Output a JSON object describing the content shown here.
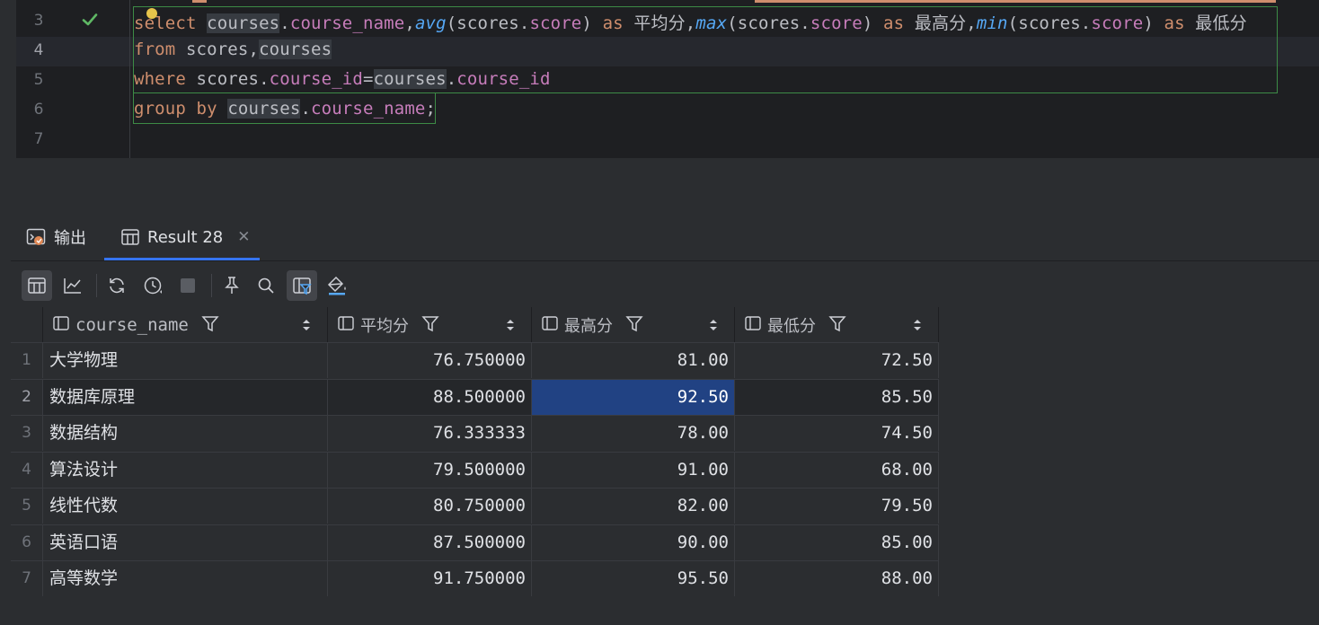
{
  "editor": {
    "line_numbers": [
      "3",
      "4",
      "5",
      "6",
      "7"
    ],
    "lines": [
      [
        {
          "t": "select",
          "c": "kw"
        },
        {
          "t": " ",
          "c": ""
        },
        {
          "t": "courses",
          "c": "hl"
        },
        {
          "t": ".",
          "c": ""
        },
        {
          "t": "course_name",
          "c": "fld"
        },
        {
          "t": ",",
          "c": ""
        },
        {
          "t": "avg",
          "c": "fn"
        },
        {
          "t": "(scores.",
          "c": ""
        },
        {
          "t": "score",
          "c": "fld"
        },
        {
          "t": ") ",
          "c": ""
        },
        {
          "t": "as",
          "c": "kw"
        },
        {
          "t": " 平均分,",
          "c": ""
        },
        {
          "t": "max",
          "c": "fn"
        },
        {
          "t": "(scores.",
          "c": ""
        },
        {
          "t": "score",
          "c": "fld"
        },
        {
          "t": ") ",
          "c": ""
        },
        {
          "t": "as",
          "c": "kw"
        },
        {
          "t": " 最高分,",
          "c": ""
        },
        {
          "t": "min",
          "c": "fn"
        },
        {
          "t": "(scores.",
          "c": ""
        },
        {
          "t": "score",
          "c": "fld"
        },
        {
          "t": ") ",
          "c": ""
        },
        {
          "t": "as",
          "c": "kw"
        },
        {
          "t": " 最低分",
          "c": ""
        }
      ],
      [
        {
          "t": "from",
          "c": "kw"
        },
        {
          "t": " scores,",
          "c": ""
        },
        {
          "t": "courses",
          "c": "hl"
        }
      ],
      [
        {
          "t": "where",
          "c": "kw"
        },
        {
          "t": " scores.",
          "c": ""
        },
        {
          "t": "course_id",
          "c": "fld"
        },
        {
          "t": "=",
          "c": ""
        },
        {
          "t": "courses",
          "c": "hl"
        },
        {
          "t": ".",
          "c": ""
        },
        {
          "t": "course_id",
          "c": "fld"
        }
      ],
      [
        {
          "t": "group by",
          "c": "kw"
        },
        {
          "t": " ",
          "c": ""
        },
        {
          "t": "courses",
          "c": "hl"
        },
        {
          "t": ".",
          "c": ""
        },
        {
          "t": "course_name",
          "c": "fld"
        },
        {
          "t": ";",
          "c": ""
        }
      ],
      []
    ],
    "colors": {
      "keyword": "#cf8e6d",
      "field": "#c77dbb",
      "function": "#56a8f5",
      "check": "#5fb865",
      "selection_outline": "#3d8b46"
    }
  },
  "panel": {
    "tabs": [
      {
        "label": "输出",
        "icon": "console-output-icon"
      },
      {
        "label": "Result 28",
        "icon": "table-grid-icon"
      }
    ],
    "toolbar_icons": [
      "table-view-icon",
      "chart-view-icon",
      "refresh-icon",
      "history-clock-icon",
      "stop-icon",
      "pin-icon",
      "search-icon",
      "filter-panel-icon",
      "paint-bucket-icon"
    ]
  },
  "result": {
    "columns": [
      "course_name",
      "平均分",
      "最高分",
      "最低分"
    ],
    "rows": [
      {
        "n": "1",
        "c": [
          "大学物理",
          "76.750000",
          "81.00",
          "72.50"
        ]
      },
      {
        "n": "2",
        "c": [
          "数据库原理",
          "88.500000",
          "92.50",
          "85.50"
        ]
      },
      {
        "n": "3",
        "c": [
          "数据结构",
          "76.333333",
          "78.00",
          "74.50"
        ]
      },
      {
        "n": "4",
        "c": [
          "算法设计",
          "79.500000",
          "91.00",
          "68.00"
        ]
      },
      {
        "n": "5",
        "c": [
          "线性代数",
          "80.750000",
          "82.00",
          "79.50"
        ]
      },
      {
        "n": "6",
        "c": [
          "英语口语",
          "87.500000",
          "90.00",
          "85.00"
        ]
      },
      {
        "n": "7",
        "c": [
          "高等数学",
          "91.750000",
          "95.50",
          "88.00"
        ]
      }
    ],
    "selected_cell": {
      "row": "2",
      "column": "最高分"
    },
    "selection_color": "#214283"
  }
}
